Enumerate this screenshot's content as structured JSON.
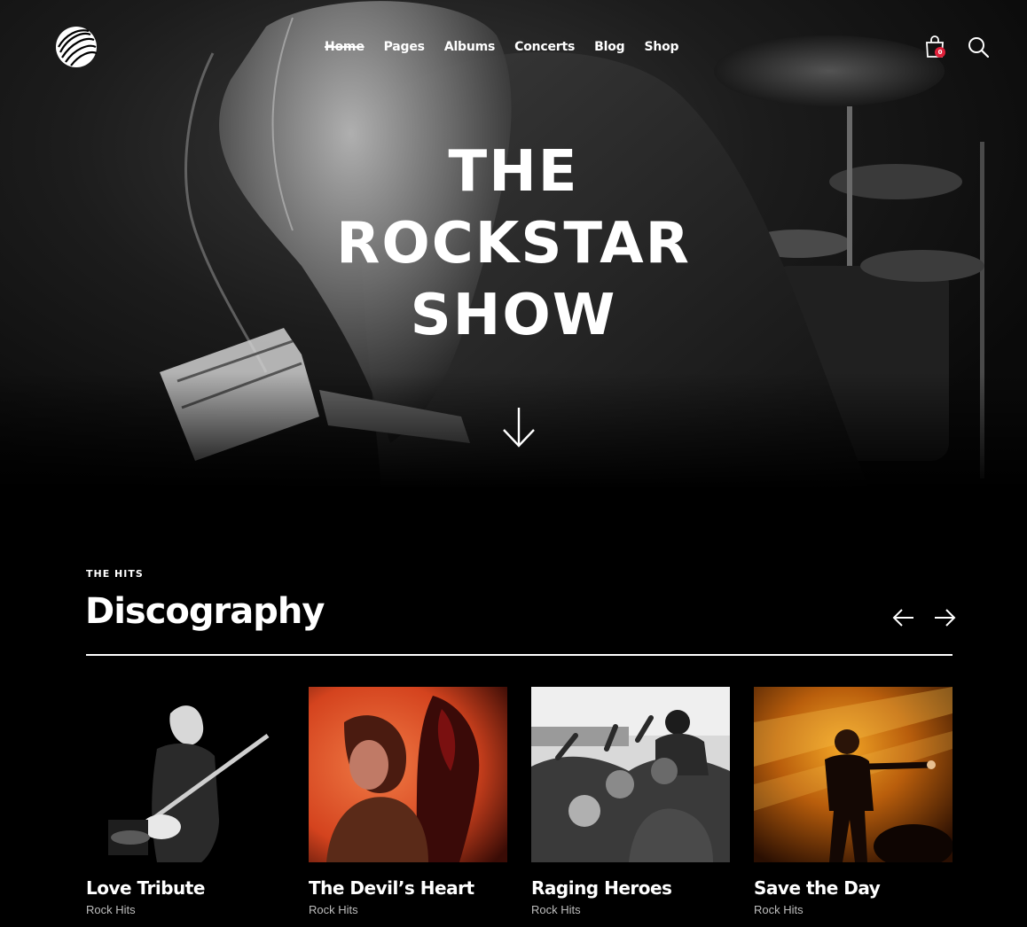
{
  "nav": {
    "items": [
      {
        "label": "Home",
        "active": true
      },
      {
        "label": "Pages",
        "active": false
      },
      {
        "label": "Albums",
        "active": false
      },
      {
        "label": "Concerts",
        "active": false
      },
      {
        "label": "Blog",
        "active": false
      },
      {
        "label": "Shop",
        "active": false
      }
    ],
    "cart_count": "0",
    "icons": [
      "logo-swirl-icon",
      "shopping-bag-icon",
      "search-icon"
    ]
  },
  "hero": {
    "title_lines": [
      "THE",
      "ROCKSTAR",
      "SHOW"
    ],
    "scroll_icon": "arrow-down-icon"
  },
  "discography": {
    "eyebrow": "THE HITS",
    "title": "Discography",
    "prev_icon": "arrow-left-icon",
    "next_icon": "arrow-right-icon",
    "albums": [
      {
        "title": "Love Tribute",
        "category": "Rock Hits"
      },
      {
        "title": "The Devil’s Heart",
        "category": "Rock Hits"
      },
      {
        "title": "Raging Heroes",
        "category": "Rock Hits"
      },
      {
        "title": "Save the Day",
        "category": "Rock Hits"
      }
    ]
  },
  "colors": {
    "background": "#000000",
    "text": "#ffffff",
    "subtext": "#bdbdbd",
    "badge": "#e0203a",
    "cover2": "#e0552a",
    "cover4": "#c9700f"
  }
}
